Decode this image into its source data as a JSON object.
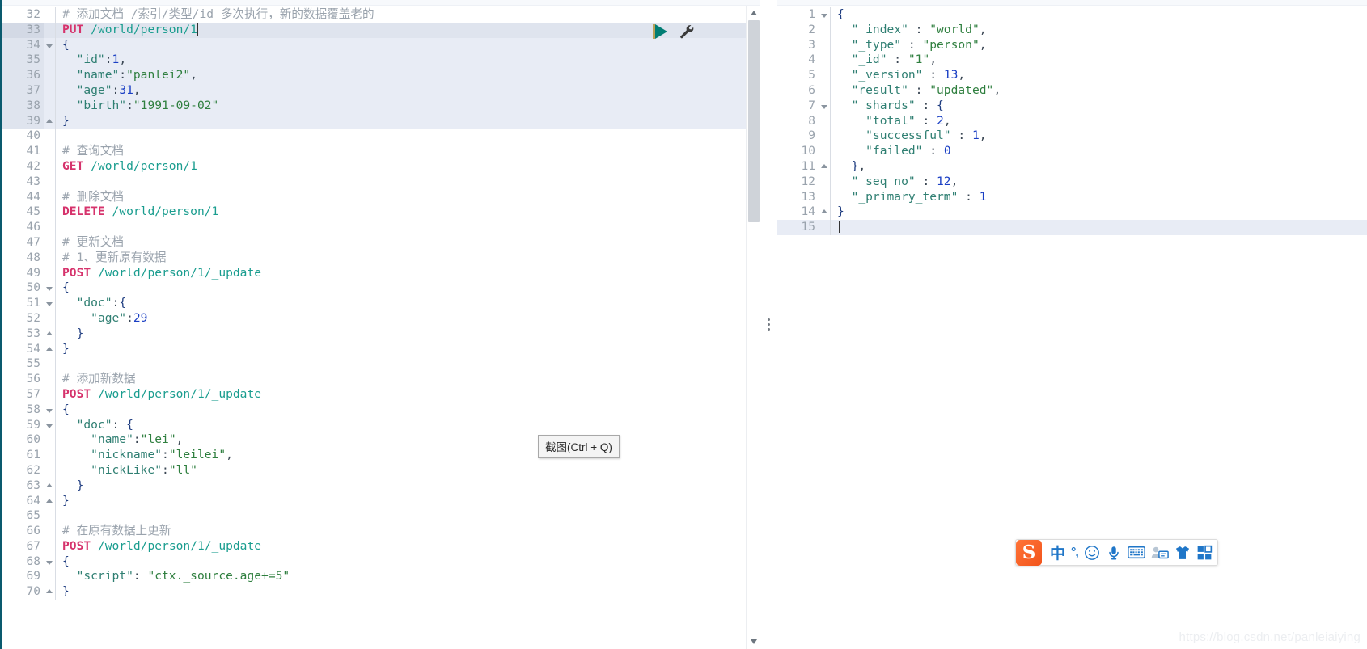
{
  "console": {
    "editor": {
      "first_line_number": 32,
      "caret_line": 33,
      "selection_lines": [
        33,
        34,
        35,
        36,
        37,
        38,
        39
      ],
      "lines": [
        {
          "n": 32,
          "fold": "",
          "tokens": [
            {
              "c": "t-comment",
              "t": "# 添加文档 /索引/类型/id 多次执行，新的数据覆盖老的"
            }
          ]
        },
        {
          "n": 33,
          "fold": "",
          "tokens": [
            {
              "c": "t-method",
              "t": "PUT"
            },
            {
              "c": "t-punct",
              "t": " "
            },
            {
              "c": "t-url",
              "t": "/world/person/1"
            }
          ],
          "caret": true
        },
        {
          "n": 34,
          "fold": "down",
          "tokens": [
            {
              "c": "t-brace",
              "t": "{"
            }
          ]
        },
        {
          "n": 35,
          "fold": "",
          "tokens": [
            {
              "c": "t-punct",
              "t": "  "
            },
            {
              "c": "t-key",
              "t": "\"id\""
            },
            {
              "c": "t-punct",
              "t": ":"
            },
            {
              "c": "t-num",
              "t": "1"
            },
            {
              "c": "t-punct",
              "t": ","
            }
          ]
        },
        {
          "n": 36,
          "fold": "",
          "tokens": [
            {
              "c": "t-punct",
              "t": "  "
            },
            {
              "c": "t-key",
              "t": "\"name\""
            },
            {
              "c": "t-punct",
              "t": ":"
            },
            {
              "c": "t-string",
              "t": "\"panlei2\""
            },
            {
              "c": "t-punct",
              "t": ","
            }
          ]
        },
        {
          "n": 37,
          "fold": "",
          "tokens": [
            {
              "c": "t-punct",
              "t": "  "
            },
            {
              "c": "t-key",
              "t": "\"age\""
            },
            {
              "c": "t-punct",
              "t": ":"
            },
            {
              "c": "t-num",
              "t": "31"
            },
            {
              "c": "t-punct",
              "t": ","
            }
          ]
        },
        {
          "n": 38,
          "fold": "",
          "tokens": [
            {
              "c": "t-punct",
              "t": "  "
            },
            {
              "c": "t-key",
              "t": "\"birth\""
            },
            {
              "c": "t-punct",
              "t": ":"
            },
            {
              "c": "t-string",
              "t": "\"1991-09-02\""
            }
          ]
        },
        {
          "n": 39,
          "fold": "up",
          "tokens": [
            {
              "c": "t-brace",
              "t": "}"
            }
          ]
        },
        {
          "n": 40,
          "fold": "",
          "tokens": []
        },
        {
          "n": 41,
          "fold": "",
          "tokens": [
            {
              "c": "t-comment",
              "t": "# 查询文档"
            }
          ]
        },
        {
          "n": 42,
          "fold": "",
          "tokens": [
            {
              "c": "t-method",
              "t": "GET"
            },
            {
              "c": "t-punct",
              "t": " "
            },
            {
              "c": "t-url",
              "t": "/world/person/1"
            }
          ]
        },
        {
          "n": 43,
          "fold": "",
          "tokens": []
        },
        {
          "n": 44,
          "fold": "",
          "tokens": [
            {
              "c": "t-comment",
              "t": "# 删除文档"
            }
          ]
        },
        {
          "n": 45,
          "fold": "",
          "tokens": [
            {
              "c": "t-method",
              "t": "DELETE"
            },
            {
              "c": "t-punct",
              "t": " "
            },
            {
              "c": "t-url",
              "t": "/world/person/1"
            }
          ]
        },
        {
          "n": 46,
          "fold": "",
          "tokens": []
        },
        {
          "n": 47,
          "fold": "",
          "tokens": [
            {
              "c": "t-comment",
              "t": "# 更新文档"
            }
          ]
        },
        {
          "n": 48,
          "fold": "",
          "tokens": [
            {
              "c": "t-comment",
              "t": "# 1、更新原有数据"
            }
          ]
        },
        {
          "n": 49,
          "fold": "",
          "tokens": [
            {
              "c": "t-method",
              "t": "POST"
            },
            {
              "c": "t-punct",
              "t": " "
            },
            {
              "c": "t-url",
              "t": "/world/person/1/_update"
            }
          ]
        },
        {
          "n": 50,
          "fold": "down",
          "tokens": [
            {
              "c": "t-brace",
              "t": "{"
            }
          ]
        },
        {
          "n": 51,
          "fold": "down",
          "tokens": [
            {
              "c": "t-punct",
              "t": "  "
            },
            {
              "c": "t-key",
              "t": "\"doc\""
            },
            {
              "c": "t-punct",
              "t": ":"
            },
            {
              "c": "t-brace",
              "t": "{"
            }
          ]
        },
        {
          "n": 52,
          "fold": "",
          "tokens": [
            {
              "c": "t-punct",
              "t": "    "
            },
            {
              "c": "t-key",
              "t": "\"age\""
            },
            {
              "c": "t-punct",
              "t": ":"
            },
            {
              "c": "t-num",
              "t": "29"
            }
          ]
        },
        {
          "n": 53,
          "fold": "up",
          "tokens": [
            {
              "c": "t-punct",
              "t": "  "
            },
            {
              "c": "t-brace",
              "t": "}"
            }
          ]
        },
        {
          "n": 54,
          "fold": "up",
          "tokens": [
            {
              "c": "t-brace",
              "t": "}"
            }
          ]
        },
        {
          "n": 55,
          "fold": "",
          "tokens": []
        },
        {
          "n": 56,
          "fold": "",
          "tokens": [
            {
              "c": "t-comment",
              "t": "# 添加新数据"
            }
          ]
        },
        {
          "n": 57,
          "fold": "",
          "tokens": [
            {
              "c": "t-method",
              "t": "POST"
            },
            {
              "c": "t-punct",
              "t": " "
            },
            {
              "c": "t-url",
              "t": "/world/person/1/_update"
            }
          ]
        },
        {
          "n": 58,
          "fold": "down",
          "tokens": [
            {
              "c": "t-brace",
              "t": "{"
            }
          ]
        },
        {
          "n": 59,
          "fold": "down",
          "tokens": [
            {
              "c": "t-punct",
              "t": "  "
            },
            {
              "c": "t-key",
              "t": "\"doc\""
            },
            {
              "c": "t-punct",
              "t": ": "
            },
            {
              "c": "t-brace",
              "t": "{"
            }
          ]
        },
        {
          "n": 60,
          "fold": "",
          "tokens": [
            {
              "c": "t-punct",
              "t": "    "
            },
            {
              "c": "t-key",
              "t": "\"name\""
            },
            {
              "c": "t-punct",
              "t": ":"
            },
            {
              "c": "t-string",
              "t": "\"lei\""
            },
            {
              "c": "t-punct",
              "t": ","
            }
          ]
        },
        {
          "n": 61,
          "fold": "",
          "tokens": [
            {
              "c": "t-punct",
              "t": "    "
            },
            {
              "c": "t-key",
              "t": "\"nickname\""
            },
            {
              "c": "t-punct",
              "t": ":"
            },
            {
              "c": "t-string",
              "t": "\"leilei\""
            },
            {
              "c": "t-punct",
              "t": ","
            }
          ]
        },
        {
          "n": 62,
          "fold": "",
          "tokens": [
            {
              "c": "t-punct",
              "t": "    "
            },
            {
              "c": "t-key",
              "t": "\"nickLike\""
            },
            {
              "c": "t-punct",
              "t": ":"
            },
            {
              "c": "t-string",
              "t": "\"ll\""
            }
          ]
        },
        {
          "n": 63,
          "fold": "up",
          "tokens": [
            {
              "c": "t-punct",
              "t": "  "
            },
            {
              "c": "t-brace",
              "t": "}"
            }
          ]
        },
        {
          "n": 64,
          "fold": "up",
          "tokens": [
            {
              "c": "t-brace",
              "t": "}"
            }
          ]
        },
        {
          "n": 65,
          "fold": "",
          "tokens": []
        },
        {
          "n": 66,
          "fold": "",
          "tokens": [
            {
              "c": "t-comment",
              "t": "# 在原有数据上更新"
            }
          ]
        },
        {
          "n": 67,
          "fold": "",
          "tokens": [
            {
              "c": "t-method",
              "t": "POST"
            },
            {
              "c": "t-punct",
              "t": " "
            },
            {
              "c": "t-url",
              "t": "/world/person/1/_update"
            }
          ]
        },
        {
          "n": 68,
          "fold": "down",
          "tokens": [
            {
              "c": "t-brace",
              "t": "{"
            }
          ]
        },
        {
          "n": 69,
          "fold": "",
          "tokens": [
            {
              "c": "t-punct",
              "t": "  "
            },
            {
              "c": "t-key",
              "t": "\"script\""
            },
            {
              "c": "t-punct",
              "t": ": "
            },
            {
              "c": "t-string",
              "t": "\"ctx._source.age+=5\""
            }
          ]
        },
        {
          "n": 70,
          "fold": "up",
          "tokens": [
            {
              "c": "t-brace",
              "t": "}"
            }
          ]
        }
      ],
      "actions": {
        "play_label": "play-request",
        "wrench_label": "request-options"
      },
      "scrollbar": {
        "up_label": "scroll-up",
        "down_label": "scroll-down"
      }
    },
    "output": {
      "lines": [
        {
          "n": 1,
          "fold": "down",
          "tokens": [
            {
              "c": "t-brace",
              "t": "{"
            }
          ]
        },
        {
          "n": 2,
          "fold": "",
          "tokens": [
            {
              "c": "t-punct",
              "t": "  "
            },
            {
              "c": "t-key",
              "t": "\"_index\""
            },
            {
              "c": "t-punct",
              "t": " : "
            },
            {
              "c": "t-string",
              "t": "\"world\""
            },
            {
              "c": "t-punct",
              "t": ","
            }
          ]
        },
        {
          "n": 3,
          "fold": "",
          "tokens": [
            {
              "c": "t-punct",
              "t": "  "
            },
            {
              "c": "t-key",
              "t": "\"_type\""
            },
            {
              "c": "t-punct",
              "t": " : "
            },
            {
              "c": "t-string",
              "t": "\"person\""
            },
            {
              "c": "t-punct",
              "t": ","
            }
          ]
        },
        {
          "n": 4,
          "fold": "",
          "tokens": [
            {
              "c": "t-punct",
              "t": "  "
            },
            {
              "c": "t-key",
              "t": "\"_id\""
            },
            {
              "c": "t-punct",
              "t": " : "
            },
            {
              "c": "t-string",
              "t": "\"1\""
            },
            {
              "c": "t-punct",
              "t": ","
            }
          ]
        },
        {
          "n": 5,
          "fold": "",
          "tokens": [
            {
              "c": "t-punct",
              "t": "  "
            },
            {
              "c": "t-key",
              "t": "\"_version\""
            },
            {
              "c": "t-punct",
              "t": " : "
            },
            {
              "c": "t-num",
              "t": "13"
            },
            {
              "c": "t-punct",
              "t": ","
            }
          ]
        },
        {
          "n": 6,
          "fold": "",
          "tokens": [
            {
              "c": "t-punct",
              "t": "  "
            },
            {
              "c": "t-key",
              "t": "\"result\""
            },
            {
              "c": "t-punct",
              "t": " : "
            },
            {
              "c": "t-string",
              "t": "\"updated\""
            },
            {
              "c": "t-punct",
              "t": ","
            }
          ]
        },
        {
          "n": 7,
          "fold": "down",
          "tokens": [
            {
              "c": "t-punct",
              "t": "  "
            },
            {
              "c": "t-key",
              "t": "\"_shards\""
            },
            {
              "c": "t-punct",
              "t": " : "
            },
            {
              "c": "t-brace",
              "t": "{"
            }
          ]
        },
        {
          "n": 8,
          "fold": "",
          "tokens": [
            {
              "c": "t-punct",
              "t": "    "
            },
            {
              "c": "t-key",
              "t": "\"total\""
            },
            {
              "c": "t-punct",
              "t": " : "
            },
            {
              "c": "t-num",
              "t": "2"
            },
            {
              "c": "t-punct",
              "t": ","
            }
          ]
        },
        {
          "n": 9,
          "fold": "",
          "tokens": [
            {
              "c": "t-punct",
              "t": "    "
            },
            {
              "c": "t-key",
              "t": "\"successful\""
            },
            {
              "c": "t-punct",
              "t": " : "
            },
            {
              "c": "t-num",
              "t": "1"
            },
            {
              "c": "t-punct",
              "t": ","
            }
          ]
        },
        {
          "n": 10,
          "fold": "",
          "tokens": [
            {
              "c": "t-punct",
              "t": "    "
            },
            {
              "c": "t-key",
              "t": "\"failed\""
            },
            {
              "c": "t-punct",
              "t": " : "
            },
            {
              "c": "t-num",
              "t": "0"
            }
          ]
        },
        {
          "n": 11,
          "fold": "up",
          "tokens": [
            {
              "c": "t-punct",
              "t": "  "
            },
            {
              "c": "t-brace",
              "t": "}"
            },
            {
              "c": "t-punct",
              "t": ","
            }
          ]
        },
        {
          "n": 12,
          "fold": "",
          "tokens": [
            {
              "c": "t-punct",
              "t": "  "
            },
            {
              "c": "t-key",
              "t": "\"_seq_no\""
            },
            {
              "c": "t-punct",
              "t": " : "
            },
            {
              "c": "t-num",
              "t": "12"
            },
            {
              "c": "t-punct",
              "t": ","
            }
          ]
        },
        {
          "n": 13,
          "fold": "",
          "tokens": [
            {
              "c": "t-punct",
              "t": "  "
            },
            {
              "c": "t-key",
              "t": "\"_primary_term\""
            },
            {
              "c": "t-punct",
              "t": " : "
            },
            {
              "c": "t-num",
              "t": "1"
            }
          ]
        },
        {
          "n": 14,
          "fold": "up",
          "tokens": [
            {
              "c": "t-brace",
              "t": "}"
            }
          ]
        },
        {
          "n": 15,
          "fold": "",
          "tokens": [],
          "caret": true,
          "highlight": true
        }
      ]
    },
    "resizer_label": "pane-resizer"
  },
  "tooltip": {
    "text": "截图(Ctrl + Q)"
  },
  "ime": {
    "logo": "S",
    "items": [
      {
        "name": "language-mode",
        "glyph": "中"
      },
      {
        "name": "punctuation-mode",
        "glyph": "°,"
      },
      {
        "name": "emoji-picker",
        "glyph": "☺"
      },
      {
        "name": "voice-input",
        "glyph": "mic"
      },
      {
        "name": "soft-keyboard",
        "glyph": "keyboard"
      },
      {
        "name": "user-card",
        "glyph": "user"
      },
      {
        "name": "skin-theme",
        "glyph": "shirt"
      },
      {
        "name": "toolbox-grid",
        "glyph": "grid"
      }
    ]
  },
  "watermark": {
    "text": "https://blog.csdn.net/panleiaiying"
  },
  "colors": {
    "accent_teal": "#017d73",
    "method_pink": "#d6336c",
    "url_teal": "#1a9d8f",
    "string_green": "#2f7f3f",
    "number_blue": "#1a3fc4",
    "selection_blue": "#e8ecf5",
    "ime_orange": "#f2541b",
    "ime_blue": "#1f76c8"
  }
}
